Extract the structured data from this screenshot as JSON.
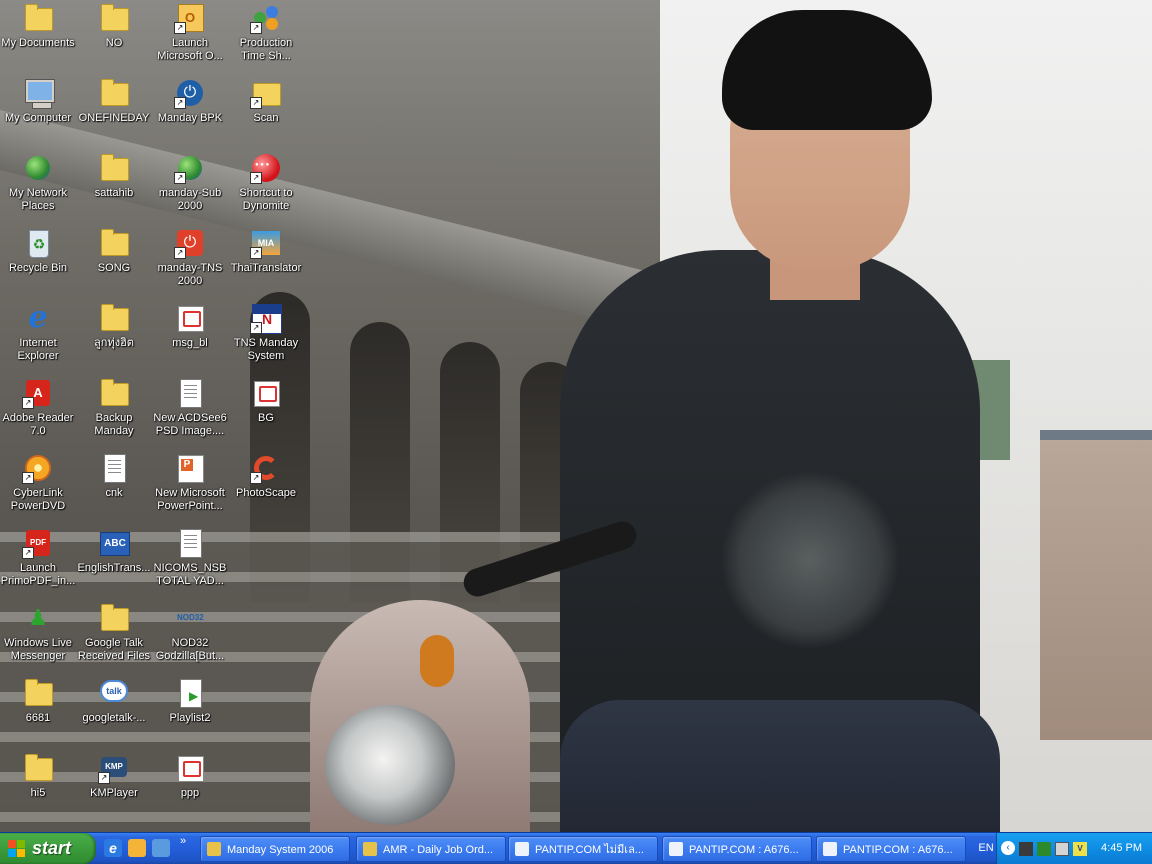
{
  "desktop": {
    "icons": [
      {
        "label": "My Documents"
      },
      {
        "label": "My Computer"
      },
      {
        "label": "My Network Places"
      },
      {
        "label": "Recycle Bin"
      },
      {
        "label": "Internet Explorer"
      },
      {
        "label": "Adobe Reader 7.0"
      },
      {
        "label": "CyberLink PowerDVD"
      },
      {
        "label": "Launch PrimoPDF_in..."
      },
      {
        "label": "Windows Live Messenger"
      },
      {
        "label": "6681"
      },
      {
        "label": "hi5"
      },
      {
        "label": "NO"
      },
      {
        "label": "ONEFINEDAY"
      },
      {
        "label": "sattahib"
      },
      {
        "label": "SONG"
      },
      {
        "label": "ลูกทุ่งฮิต"
      },
      {
        "label": "Backup Manday"
      },
      {
        "label": "cnk"
      },
      {
        "label": "EnglishTrans..."
      },
      {
        "label": "Google Talk Received Files"
      },
      {
        "label": "googletalk-..."
      },
      {
        "label": "KMPlayer"
      },
      {
        "label": "Launch Microsoft O..."
      },
      {
        "label": "Manday BPK"
      },
      {
        "label": "manday-Sub 2000"
      },
      {
        "label": "manday-TNS 2000"
      },
      {
        "label": "msg_bl"
      },
      {
        "label": "New ACDSee6 PSD Image...."
      },
      {
        "label": "New Microsoft PowerPoint..."
      },
      {
        "label": "NICOMS_NSB TOTAL YAD..."
      },
      {
        "label": "NOD32 Godzilla[But..."
      },
      {
        "label": "Playlist2"
      },
      {
        "label": "ppp"
      },
      {
        "label": "Production Time Sh..."
      },
      {
        "label": "Scan"
      },
      {
        "label": "Shortcut to Dynomite"
      },
      {
        "label": "ThaiTranslator"
      },
      {
        "label": "TNS Manday System"
      },
      {
        "label": "BG"
      },
      {
        "label": "PhotoScape"
      }
    ]
  },
  "taskbar": {
    "start_label": "start",
    "quicklaunch_more": "»",
    "buttons": [
      {
        "label": "Manday System 2006"
      },
      {
        "label": "AMR - Daily Job Ord..."
      },
      {
        "label": "PANTIP.COM ไม่มีเล..."
      },
      {
        "label": "PANTIP.COM : A676..."
      },
      {
        "label": "PANTIP.COM : A676..."
      }
    ],
    "language": "EN",
    "tray_chevron": "‹",
    "clock": "4:45 PM",
    "colors": {
      "start_green": "#3c9c3c",
      "taskbar_blue": "#245edb",
      "tray_blue": "#0d8de3"
    }
  }
}
